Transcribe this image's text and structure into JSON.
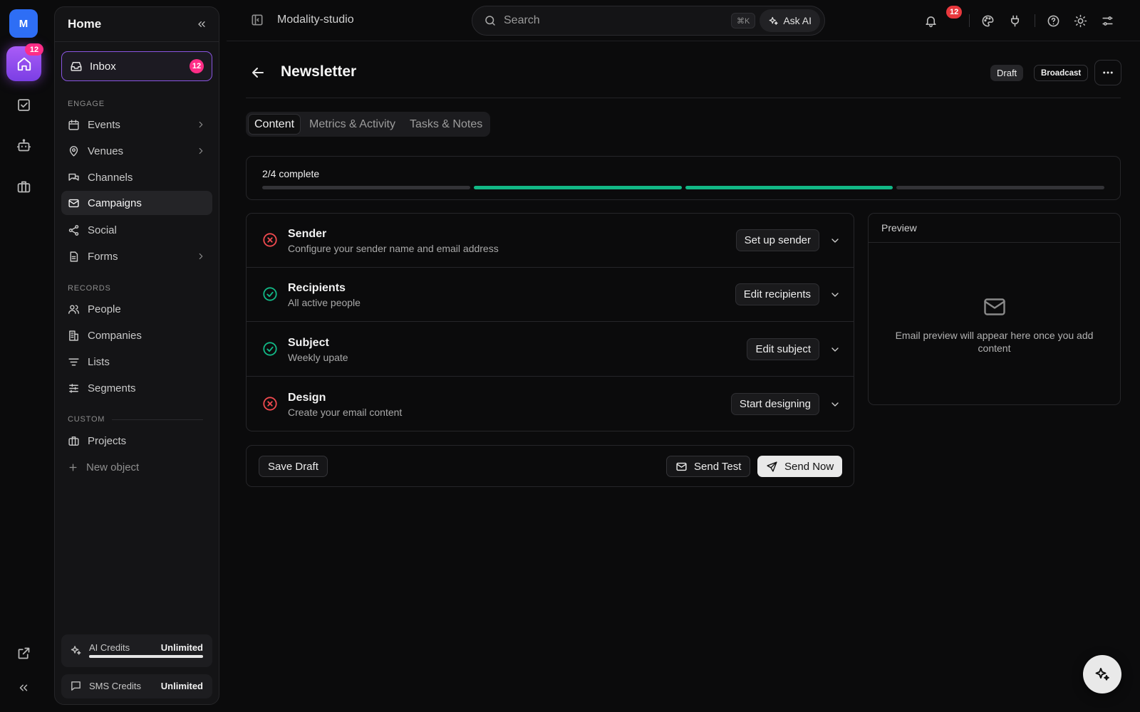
{
  "rail": {
    "avatar_letter": "M",
    "home_badge": "12"
  },
  "sidebar": {
    "title": "Home",
    "inbox": {
      "label": "Inbox",
      "badge": "12"
    },
    "sections": {
      "engage": "ENGAGE",
      "records": "RECORDS",
      "custom": "CUSTOM"
    },
    "engage_items": [
      {
        "label": "Events"
      },
      {
        "label": "Venues"
      },
      {
        "label": "Channels"
      },
      {
        "label": "Campaigns"
      },
      {
        "label": "Social"
      },
      {
        "label": "Forms"
      }
    ],
    "records_items": [
      {
        "label": "People"
      },
      {
        "label": "Companies"
      },
      {
        "label": "Lists"
      },
      {
        "label": "Segments"
      }
    ],
    "custom_items": [
      {
        "label": "Projects"
      }
    ],
    "new_object_label": "New object",
    "credits": [
      {
        "label": "AI Credits",
        "value": "Unlimited",
        "progress": 1.0
      },
      {
        "label": "SMS Credits",
        "value": "Unlimited"
      }
    ]
  },
  "topbar": {
    "workspace": "Modality-studio",
    "search_placeholder": "Search",
    "shortcut": "⌘K",
    "ask_ai": "Ask AI",
    "notification_badge": "12"
  },
  "page": {
    "title": "Newsletter",
    "status_pill": "Draft",
    "type_pill": "Broadcast",
    "tabs": [
      {
        "label": "Content",
        "active": true
      },
      {
        "label": "Metrics & Activity"
      },
      {
        "label": "Tasks & Notes"
      }
    ],
    "progress": {
      "label": "2/4 complete",
      "completed": 2,
      "total": 4
    },
    "steps": [
      {
        "title": "Sender",
        "subtitle": "Configure your sender name and email address",
        "action": "Set up sender",
        "status": "incomplete"
      },
      {
        "title": "Recipients",
        "subtitle": "All active people",
        "action": "Edit recipients",
        "status": "complete"
      },
      {
        "title": "Subject",
        "subtitle": "Weekly upate",
        "action": "Edit subject",
        "status": "complete"
      },
      {
        "title": "Design",
        "subtitle": "Create your email content",
        "action": "Start designing",
        "status": "incomplete"
      }
    ],
    "actions": {
      "save_draft": "Save Draft",
      "send_test": "Send Test",
      "send_now": "Send Now"
    },
    "preview": {
      "title": "Preview",
      "empty_text": "Email preview will appear here once you add content"
    }
  },
  "colors": {
    "accent_purple": "#8a55e2",
    "badge_pink": "#ff2d87",
    "notify_red": "#e8383d",
    "success_green": "#12b886",
    "error_red": "#f04a4f"
  }
}
